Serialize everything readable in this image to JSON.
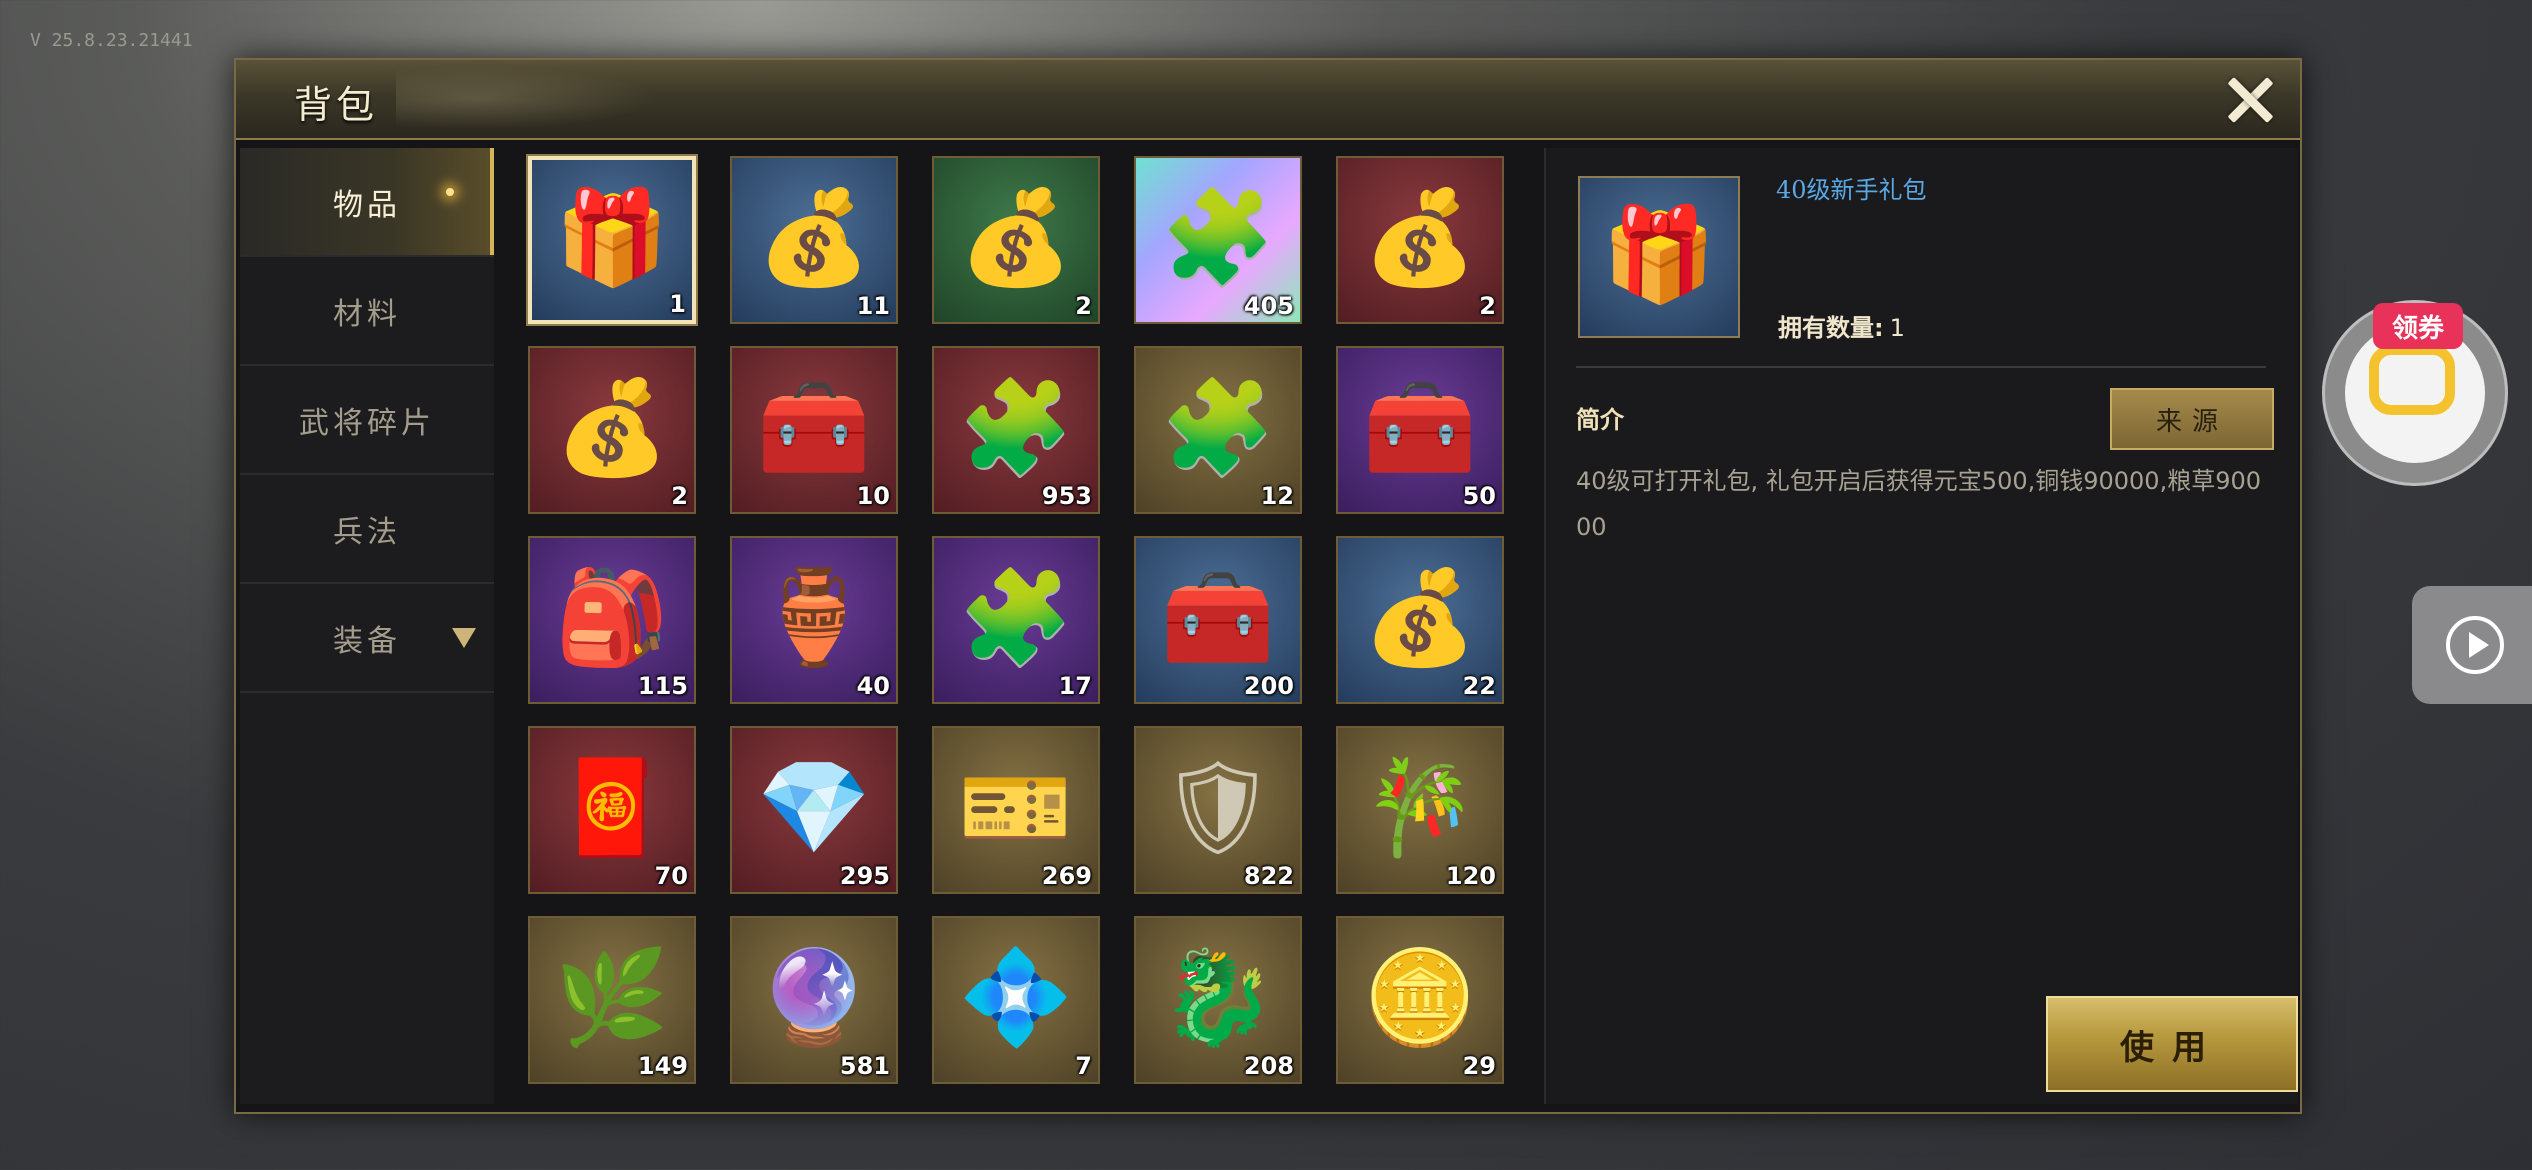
{
  "version": "V 25.8.23.21441",
  "window": {
    "title": "背包"
  },
  "tabs": [
    {
      "label": "物品",
      "active": true
    },
    {
      "label": "材料"
    },
    {
      "label": "武将碎片"
    },
    {
      "label": "兵法"
    },
    {
      "label": "装备",
      "has_dropdown": true
    }
  ],
  "items": [
    {
      "icon": "🎁",
      "icon_name": "gift-box-icon",
      "count": "1",
      "frame": "blue",
      "selected": true
    },
    {
      "icon": "💰",
      "icon_name": "blue-pouch-icon",
      "count": "11",
      "frame": "blue"
    },
    {
      "icon": "💰",
      "icon_name": "green-pouch-icon",
      "count": "2",
      "frame": "green"
    },
    {
      "icon": "🧩",
      "icon_name": "rainbow-puzzle-icon",
      "count": "405",
      "frame": "rainbow"
    },
    {
      "icon": "💰",
      "icon_name": "gold-pouch-icon",
      "count": "2",
      "frame": "red"
    },
    {
      "icon": "💰",
      "icon_name": "orange-pouch-icon",
      "count": "2",
      "frame": "red"
    },
    {
      "icon": "🧰",
      "icon_name": "treasure-chest-icon",
      "count": "10",
      "frame": "red"
    },
    {
      "icon": "🧩",
      "icon_name": "red-puzzle-icon",
      "count": "953",
      "frame": "red"
    },
    {
      "icon": "🧩",
      "icon_name": "gold-puzzle-icon",
      "count": "12",
      "frame": "gold"
    },
    {
      "icon": "🧰",
      "icon_name": "red-chest-icon",
      "count": "50",
      "frame": "purple"
    },
    {
      "icon": "🎒",
      "icon_name": "red-bag-icon",
      "count": "115",
      "frame": "purple"
    },
    {
      "icon": "🏺",
      "icon_name": "treasure-bowl-icon",
      "count": "40",
      "frame": "purple"
    },
    {
      "icon": "🧩",
      "icon_name": "purple-puzzle-icon",
      "count": "17",
      "frame": "purple"
    },
    {
      "icon": "🧰",
      "icon_name": "purple-chest-icon",
      "count": "200",
      "frame": "blue"
    },
    {
      "icon": "💰",
      "icon_name": "scroll-bag-icon",
      "count": "22",
      "frame": "blue"
    },
    {
      "icon": "🧧",
      "icon_name": "red-envelope-icon",
      "count": "70",
      "frame": "red"
    },
    {
      "icon": "💎",
      "icon_name": "red-crystal-icon",
      "count": "295",
      "frame": "red"
    },
    {
      "icon": "🎫",
      "icon_name": "coupon-ticket-icon",
      "count": "269",
      "frame": "gold"
    },
    {
      "icon": "🛡",
      "icon_name": "explore-token-icon",
      "count": "822",
      "frame": "gold"
    },
    {
      "icon": "🎋",
      "icon_name": "jade-scroll-icon",
      "count": "120",
      "frame": "gold"
    },
    {
      "icon": "🌿",
      "icon_name": "grass-icon",
      "count": "149",
      "frame": "gold"
    },
    {
      "icon": "🔮",
      "icon_name": "purple-orb-icon",
      "count": "581",
      "frame": "gold"
    },
    {
      "icon": "💠",
      "icon_name": "silver-gem-icon",
      "count": "7",
      "frame": "gold"
    },
    {
      "icon": "🐉",
      "icon_name": "jade-dragon-icon",
      "count": "208",
      "frame": "gold"
    },
    {
      "icon": "🪙",
      "icon_name": "gold-coin-icon",
      "count": "29",
      "frame": "gold"
    }
  ],
  "detail": {
    "icon": "🎁",
    "name": "40级新手礼包",
    "own_label": "拥有数量:",
    "own_value": "1",
    "intro_label": "简介",
    "source_button": "来源",
    "description": "40级可打开礼包, 礼包开启后获得元宝500,铜钱90000,粮草90000",
    "use_button": "使用"
  },
  "side": {
    "coupon_label": "领券"
  }
}
